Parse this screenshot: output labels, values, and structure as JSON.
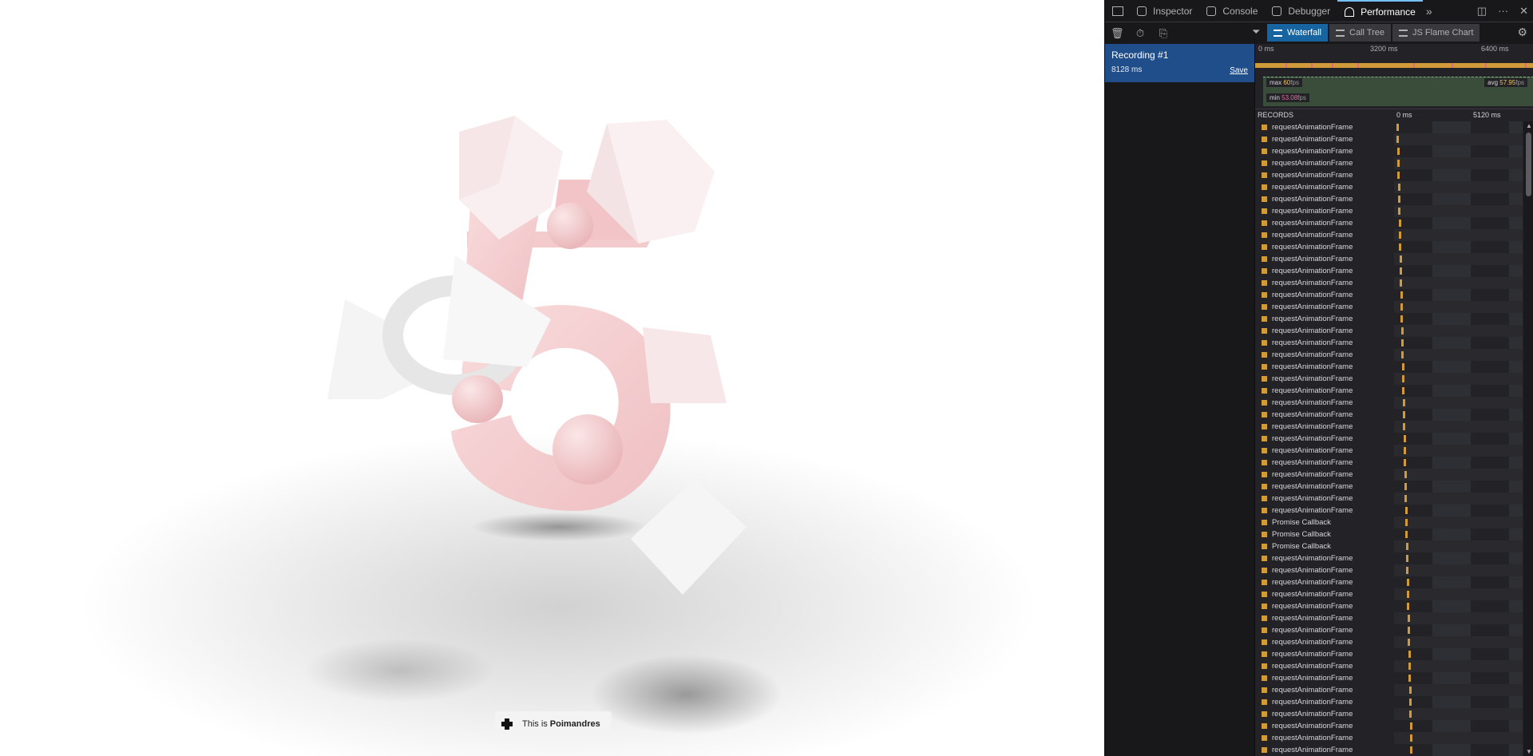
{
  "scene": {
    "badge_prefix": "This is",
    "badge_brand": "Poimandres"
  },
  "devtools": {
    "tabs": [
      {
        "label": "Inspector",
        "icon": "inspector-icon"
      },
      {
        "label": "Console",
        "icon": "console-icon"
      },
      {
        "label": "Debugger",
        "icon": "debugger-icon"
      },
      {
        "label": "Performance",
        "icon": "performance-icon",
        "active": true
      }
    ],
    "subtabs": [
      {
        "label": "Waterfall",
        "active": true
      },
      {
        "label": "Call Tree"
      },
      {
        "label": "JS Flame Chart"
      }
    ],
    "recording": {
      "name": "Recording #1",
      "duration": "8128 ms",
      "save_label": "Save"
    },
    "overview": {
      "ticks": [
        "0 ms",
        "3200 ms",
        "6400 ms"
      ],
      "fps_max_label": "max",
      "fps_max": "60",
      "fps_avg_label": "avg",
      "fps_avg": "57.95",
      "fps_min_label": "min",
      "fps_min": "53.08",
      "fps_unit": "fps"
    },
    "records_header": "RECORDS",
    "waterfall_ticks": [
      "0 ms",
      "5120 ms"
    ],
    "records": [
      "requestAnimationFrame",
      "requestAnimationFrame",
      "requestAnimationFrame",
      "requestAnimationFrame",
      "requestAnimationFrame",
      "requestAnimationFrame",
      "requestAnimationFrame",
      "requestAnimationFrame",
      "requestAnimationFrame",
      "requestAnimationFrame",
      "requestAnimationFrame",
      "requestAnimationFrame",
      "requestAnimationFrame",
      "requestAnimationFrame",
      "requestAnimationFrame",
      "requestAnimationFrame",
      "requestAnimationFrame",
      "requestAnimationFrame",
      "requestAnimationFrame",
      "requestAnimationFrame",
      "requestAnimationFrame",
      "requestAnimationFrame",
      "requestAnimationFrame",
      "requestAnimationFrame",
      "requestAnimationFrame",
      "requestAnimationFrame",
      "requestAnimationFrame",
      "requestAnimationFrame",
      "requestAnimationFrame",
      "requestAnimationFrame",
      "requestAnimationFrame",
      "requestAnimationFrame",
      "requestAnimationFrame",
      "Promise Callback",
      "Promise Callback",
      "Promise Callback",
      "requestAnimationFrame",
      "requestAnimationFrame",
      "requestAnimationFrame",
      "requestAnimationFrame",
      "requestAnimationFrame",
      "requestAnimationFrame",
      "requestAnimationFrame",
      "requestAnimationFrame",
      "requestAnimationFrame",
      "requestAnimationFrame",
      "requestAnimationFrame",
      "requestAnimationFrame",
      "requestAnimationFrame",
      "requestAnimationFrame",
      "requestAnimationFrame",
      "requestAnimationFrame",
      "requestAnimationFrame"
    ]
  }
}
